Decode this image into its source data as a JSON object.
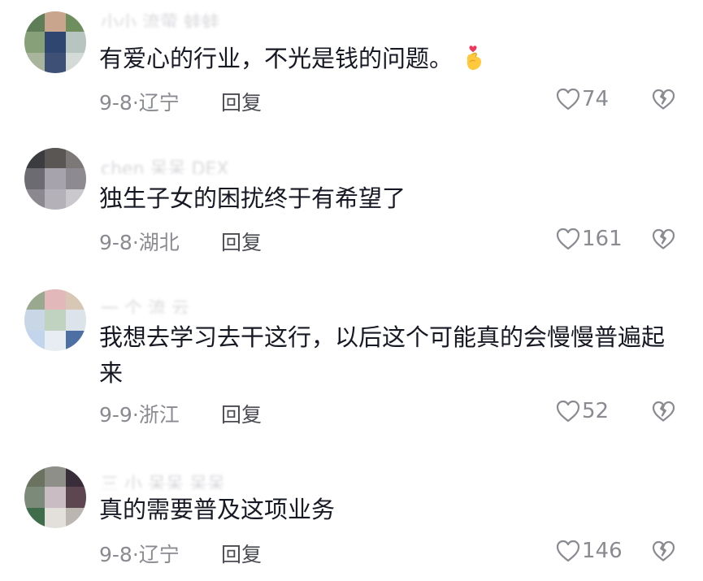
{
  "comments": [
    {
      "username": "小小 流萤 蛙蛙",
      "text": "有爱心的行业，不光是钱的问题。",
      "emoji": "finger-heart-emoji",
      "date": "9-8",
      "location": "辽宁",
      "reply_label": "回复",
      "likes": "74"
    },
    {
      "username": "chen 呆呆 DEX",
      "text": "独生子女的困扰终于有希望了",
      "date": "9-8",
      "location": "湖北",
      "reply_label": "回复",
      "likes": "161"
    },
    {
      "username": "一 个 流 云",
      "text": "我想去学习去干这行，以后这个可能真的会慢慢普遍起来",
      "date": "9-9",
      "location": "浙江",
      "reply_label": "回复",
      "likes": "52"
    },
    {
      "username": "三 小 呆呆 呆呆",
      "text": "真的需要普及这项业务",
      "date": "9-8",
      "location": "辽宁",
      "reply_label": "回复",
      "likes": "146"
    }
  ],
  "colors": {
    "text_primary": "#161823",
    "text_secondary": "#8a8b91",
    "reply": "#4a4b52",
    "icon": "#8a8b91"
  },
  "icons": {
    "like": "heart-outline-icon",
    "dislike": "broken-heart-icon"
  }
}
